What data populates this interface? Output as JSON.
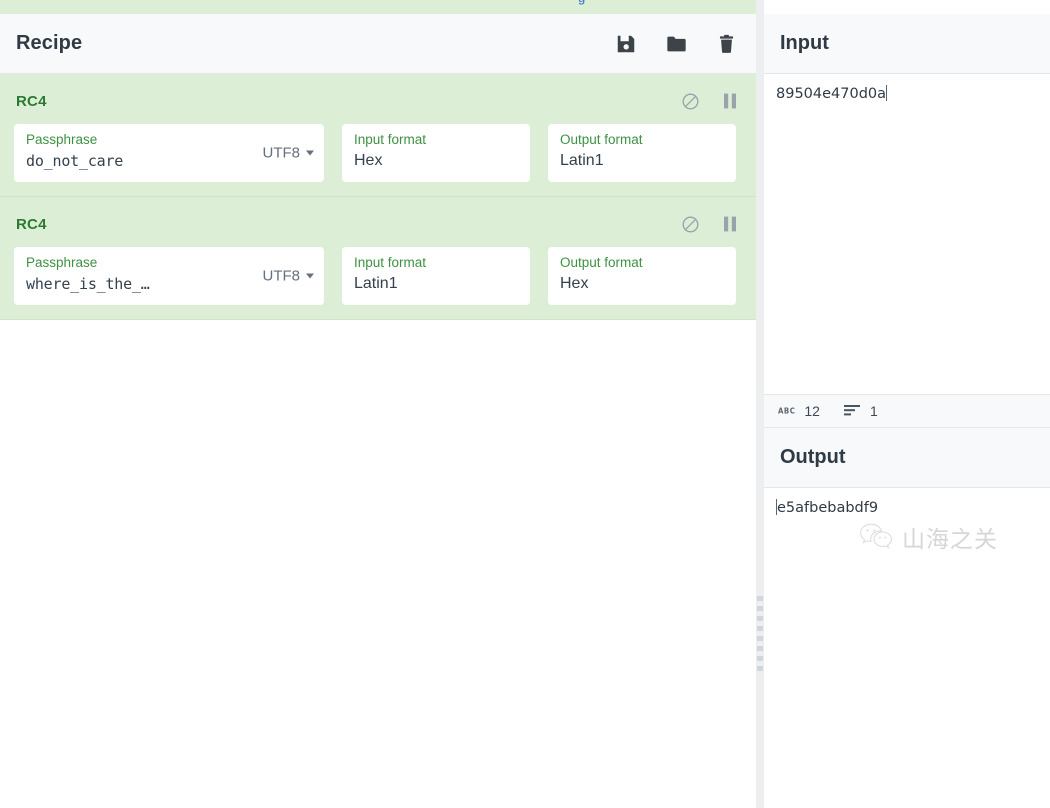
{
  "top_fragment": "g",
  "recipe": {
    "title": "Recipe",
    "actions": [
      {
        "name": "save-recipe",
        "icon": "save-icon",
        "label": "Save recipe"
      },
      {
        "name": "load-recipe",
        "icon": "folder-icon",
        "label": "Load recipe"
      },
      {
        "name": "clear-recipe",
        "icon": "trash-icon",
        "label": "Clear recipe"
      }
    ],
    "operations": [
      {
        "title": "RC4",
        "disable_icon": "disable-icon",
        "breakpoint_icon": "pause-icon",
        "args": {
          "passphrase_label": "Passphrase",
          "passphrase_value": "do_not_care",
          "passphrase_encoding": "UTF8",
          "input_format_label": "Input format",
          "input_format_value": "Hex",
          "output_format_label": "Output format",
          "output_format_value": "Latin1"
        }
      },
      {
        "title": "RC4",
        "disable_icon": "disable-icon",
        "breakpoint_icon": "pause-icon",
        "args": {
          "passphrase_label": "Passphrase",
          "passphrase_value": "where_is_the_…",
          "passphrase_encoding": "UTF8",
          "input_format_label": "Input format",
          "input_format_value": "Latin1",
          "output_format_label": "Output format",
          "output_format_value": "Hex"
        }
      }
    ]
  },
  "input": {
    "title": "Input",
    "value": "89504e470d0a",
    "status": {
      "length_icon": "abc-icon",
      "length": "12",
      "lines_icon": "lines-icon",
      "lines": "1"
    }
  },
  "output": {
    "title": "Output",
    "value": "e5afbebabdf9"
  },
  "watermark": {
    "icon": "wechat-icon",
    "text": "山海之关"
  },
  "colors": {
    "operation_bg": "#ddeed6",
    "operation_title": "#2c7a32",
    "arg_label": "#3e9142",
    "header_bg": "#f8f9fa",
    "splitter": "#eceef0"
  }
}
